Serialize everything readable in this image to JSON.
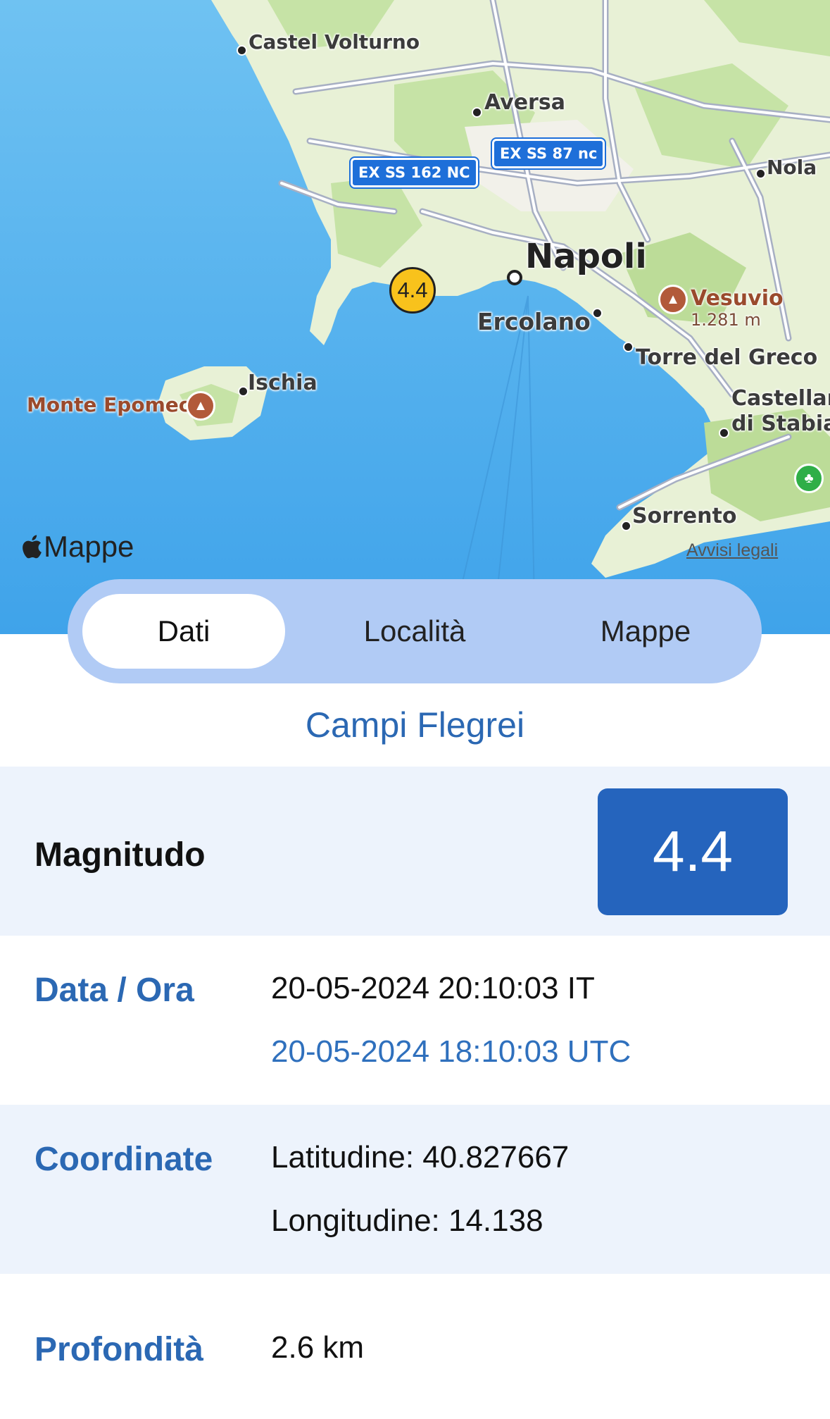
{
  "map": {
    "brand": "Mappe",
    "legal_link": "Avvisi legali",
    "marker_label": "4.4",
    "places": {
      "castel_volturno": "Castel Volturno",
      "aversa": "Aversa",
      "nola": "Nola",
      "napoli": "Napoli",
      "ercolano": "Ercolano",
      "torre_del_greco": "Torre del Greco",
      "castellammare": "Castellan",
      "di_stabia": "di Stabia",
      "ischia": "Ischia",
      "monte_epomeo": "Monte Epomeo",
      "sorrento": "Sorrento",
      "vesuvio": "Vesuvio",
      "vesuvio_height": "1.281 m"
    },
    "road_shields": [
      "EX SS 162 NC",
      "EX SS 87 nc"
    ],
    "colors": {
      "sea": "#5bb4ee",
      "land": "#e9f1d8",
      "marker": "#f8c21c"
    }
  },
  "tabs": [
    {
      "label": "Dati",
      "active": true
    },
    {
      "label": "Località",
      "active": false
    },
    {
      "label": "Mappe",
      "active": false
    }
  ],
  "place_title": "Campi Flegrei",
  "details": {
    "magnitudo": {
      "label": "Magnitudo",
      "value": "4.4"
    },
    "data_ora": {
      "label": "Data / Ora",
      "local": "20-05-2024 20:10:03 IT",
      "utc": "20-05-2024 18:10:03 UTC"
    },
    "coordinate": {
      "label": "Coordinate",
      "latitudine": "Latitudine: 40.827667",
      "longitudine": "Longitudine: 14.138"
    },
    "profondita": {
      "label": "Profondità",
      "value": "2.6 km"
    }
  },
  "colors": {
    "accent": "#2b68b3",
    "magnitude_box": "#2564bd",
    "segmented_bg": "#b1cbf5",
    "row_shade": "#edf3fc"
  }
}
